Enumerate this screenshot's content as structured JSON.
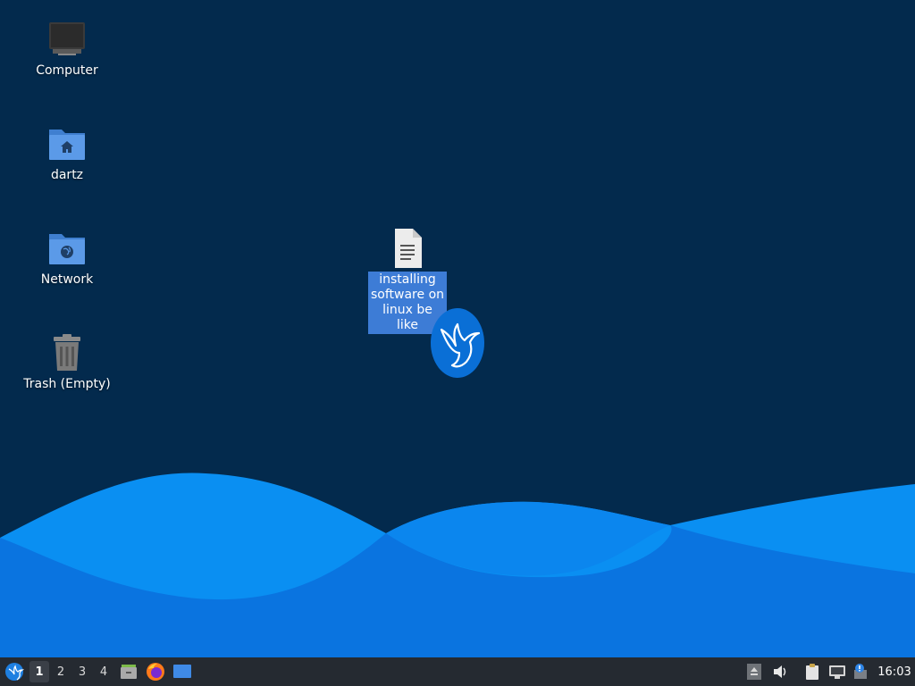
{
  "desktop": {
    "colors": {
      "background": "#032a4d",
      "wave_light": "#0b8bf0",
      "wave_dark": "#0a6fdd",
      "selection": "#3d7cd6"
    },
    "icons": [
      {
        "id": "computer",
        "label": "Computer",
        "icon": "computer-icon"
      },
      {
        "id": "home",
        "label": "dartz",
        "icon": "home-folder-icon"
      },
      {
        "id": "network",
        "label": "Network",
        "icon": "network-folder-icon"
      },
      {
        "id": "trash",
        "label": "Trash (Empty)",
        "icon": "trash-icon"
      },
      {
        "id": "file",
        "label": "installing software on linux be like",
        "icon": "text-document-icon",
        "selected": true
      }
    ],
    "logo": "hummingbird-logo"
  },
  "taskbar": {
    "menu_icon": "whisker-menu-icon",
    "workspaces": [
      "1",
      "2",
      "3",
      "4"
    ],
    "active_workspace": "1",
    "launchers": [
      "file-manager-icon",
      "firefox-icon",
      "show-desktop-icon"
    ],
    "tray": [
      "eject-icon",
      "volume-icon",
      "clipboard-icon",
      "network-icon",
      "updates-icon"
    ],
    "clock": "16:03"
  }
}
